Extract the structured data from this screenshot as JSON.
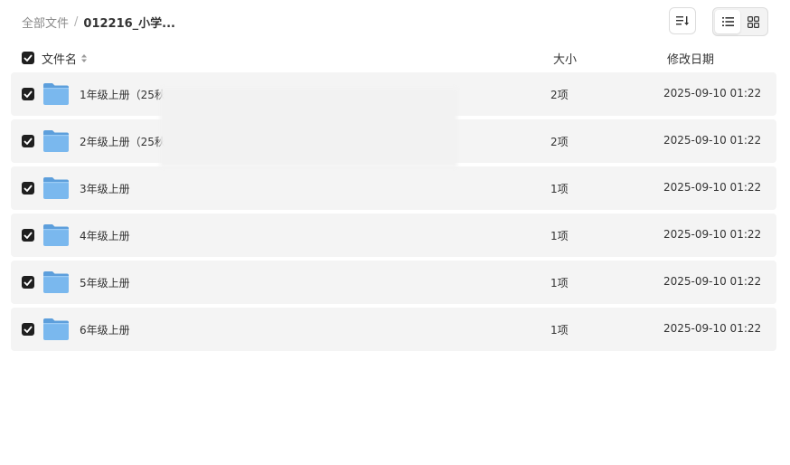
{
  "breadcrumb": {
    "root": "全部文件",
    "separator": "/",
    "current": "012216_小学..."
  },
  "toolbar": {
    "sort_icon": "sort-list-icon",
    "list_view_icon": "list-view-icon",
    "grid_view_icon": "grid-view-icon"
  },
  "table": {
    "headers": {
      "name": "文件名",
      "size": "大小",
      "date": "修改日期"
    },
    "rows": [
      {
        "name": "1年级上册（25秋",
        "size": "2项",
        "date": "2025-09-10 01:22",
        "checked": true
      },
      {
        "name": "2年级上册（25秋",
        "size": "2项",
        "date": "2025-09-10 01:22",
        "checked": true
      },
      {
        "name": "3年级上册",
        "size": "1项",
        "date": "2025-09-10 01:22",
        "checked": true
      },
      {
        "name": "4年级上册",
        "size": "1项",
        "date": "2025-09-10 01:22",
        "checked": true
      },
      {
        "name": "5年级上册",
        "size": "1项",
        "date": "2025-09-10 01:22",
        "checked": true
      },
      {
        "name": "6年级上册",
        "size": "1项",
        "date": "2025-09-10 01:22",
        "checked": true
      }
    ]
  },
  "colors": {
    "checkbox": "#1f1f1f",
    "folder": "#6aaee8",
    "row_bg": "#f4f4f4"
  }
}
